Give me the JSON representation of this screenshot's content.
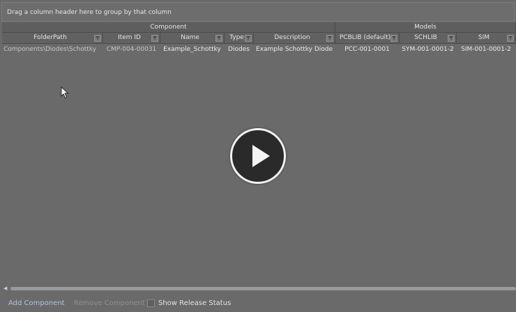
{
  "group_panel": {
    "hint": "Drag a column header here to group by that column"
  },
  "bands": [
    {
      "label": "Component",
      "width": 478
    },
    {
      "label": "Models",
      "width": 259
    }
  ],
  "columns": [
    {
      "label": "FolderPath",
      "width": 145
    },
    {
      "label": "Item ID",
      "width": 82
    },
    {
      "label": "Name",
      "width": 92
    },
    {
      "label": "Type",
      "width": 42
    },
    {
      "label": "Description",
      "width": 117
    },
    {
      "label": "PCBLIB (default)",
      "width": 92
    },
    {
      "label": "SCHLIB",
      "width": 82
    },
    {
      "label": "SIM",
      "width": 85
    }
  ],
  "rows": [
    {
      "cells": [
        "Components\\Diodes\\Schottky",
        "CMP-004-00031",
        "Example_Schottky",
        "Diodes",
        "Example Schottky Diode",
        "PCC-001-0001",
        "SYM-001-0001-2",
        "SIM-001-0001-2"
      ]
    }
  ],
  "footer": {
    "add_label": "Add Component",
    "remove_label": "Remove Component",
    "show_release_label": "Show Release Status",
    "show_release_checked": false
  },
  "icons": {
    "filter": "funnel-icon",
    "play": "play-icon",
    "cursor": "mouse-pointer-icon",
    "scroll_left": "scroll-left-arrow-icon"
  }
}
